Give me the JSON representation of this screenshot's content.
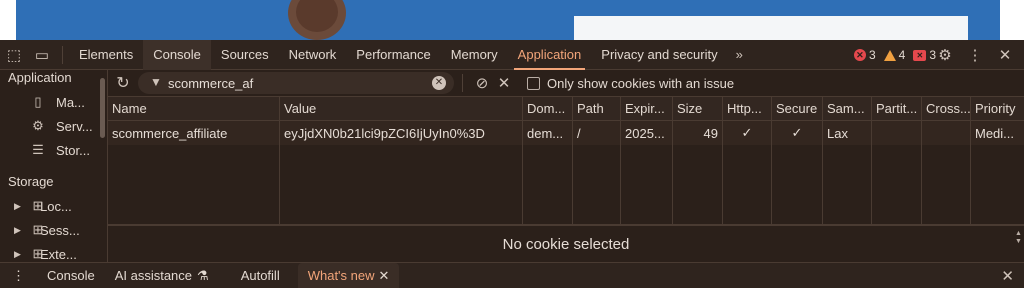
{
  "toolbar": {
    "tabs": [
      "Elements",
      "Console",
      "Sources",
      "Network",
      "Performance",
      "Memory",
      "Application",
      "Privacy and security"
    ],
    "more": "»",
    "errors": "3",
    "warnings": "4",
    "issues": "3"
  },
  "sidebar": {
    "application_header": "Application",
    "app_items": [
      "Ma...",
      "Serv...",
      "Stor..."
    ],
    "storage_header": "Storage",
    "storage_items": [
      "Loc...",
      "Sess...",
      "Exte..."
    ]
  },
  "filter": {
    "value": "scommerce_af",
    "only_issue_label": "Only show cookies with an issue"
  },
  "table": {
    "headers": [
      "Name",
      "Value",
      "Dom...",
      "Path",
      "Expir...",
      "Size",
      "Http...",
      "Secure",
      "Sam...",
      "Partit...",
      "Cross...",
      "Priority"
    ],
    "rows": [
      [
        "scommerce_affiliate",
        "eyJjdXN0b21lci9pZCI6IjUyIn0%3D",
        "dem...",
        "/",
        "2025...",
        "49",
        "✓",
        "✓",
        "Lax",
        "",
        "",
        "Medi..."
      ]
    ]
  },
  "preview": {
    "empty_text": "No cookie selected"
  },
  "drawer": {
    "tabs": [
      "Console",
      "AI assistance",
      "Autofill",
      "What's new"
    ]
  }
}
